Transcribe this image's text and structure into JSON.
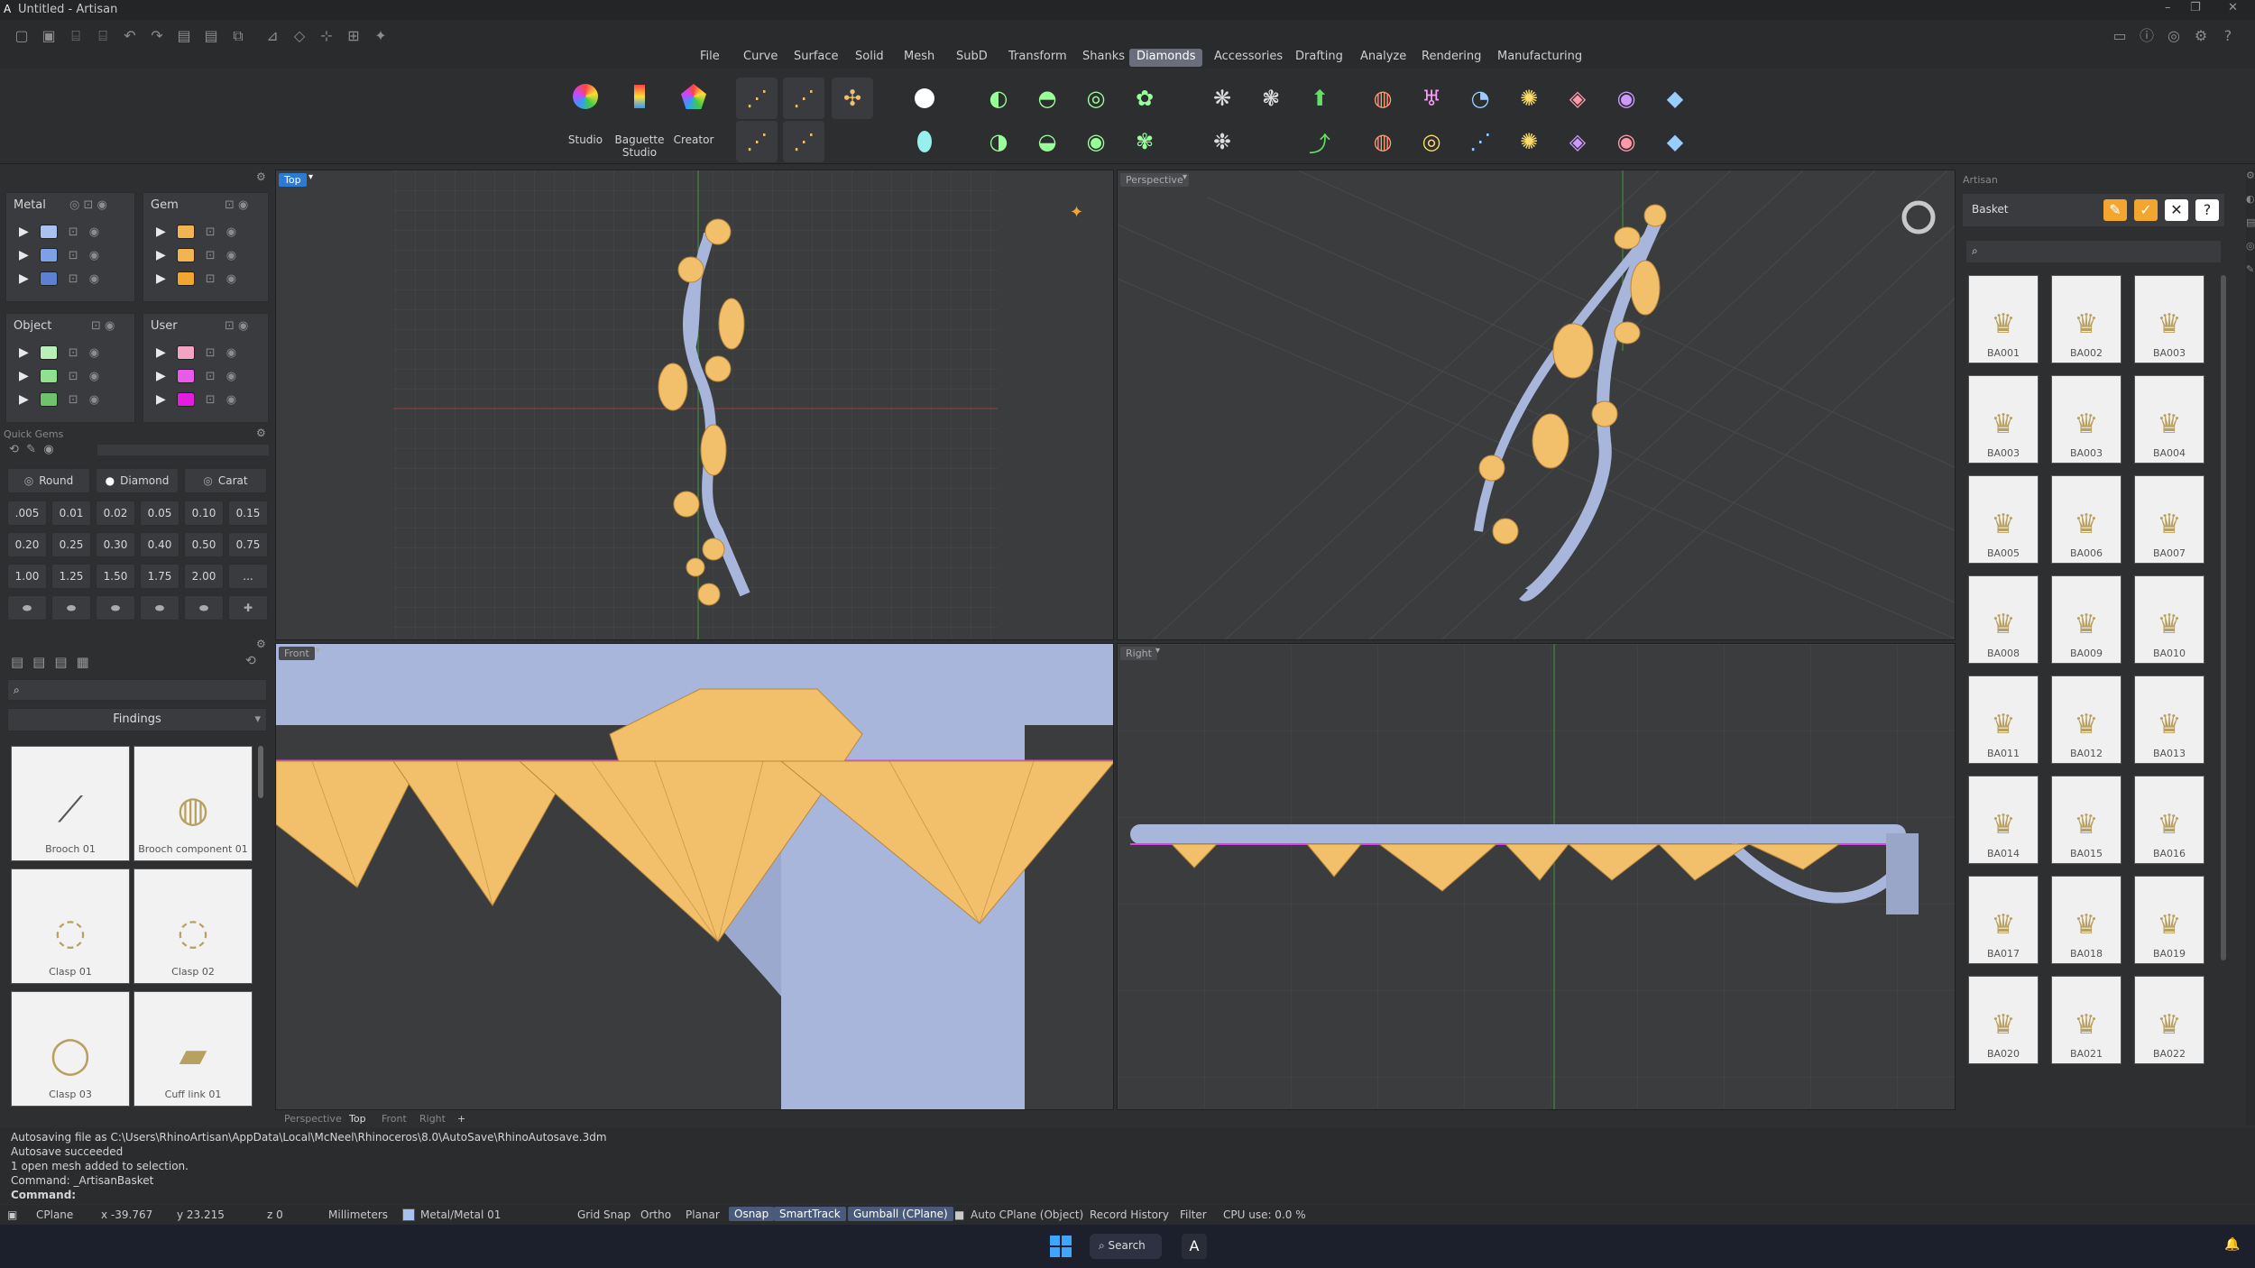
{
  "title_bar": {
    "title": "Untitled - Artisan"
  },
  "menu": {
    "tabs": [
      "File",
      "Curve",
      "Surface",
      "Solid",
      "Mesh",
      "SubD",
      "Transform",
      "Shanks",
      "Diamonds",
      "Accessories",
      "Drafting",
      "Analyze",
      "Rendering",
      "Manufacturing"
    ],
    "active": "Diamonds"
  },
  "ribbon": {
    "studio": "Studio",
    "baguette": "Baguette Studio",
    "creator": "Creator"
  },
  "layers": {
    "metal": {
      "title": "Metal",
      "colors": [
        "#a9c0f0",
        "#7ea0e6",
        "#5d80d0"
      ]
    },
    "gem": {
      "title": "Gem",
      "colors": [
        "#f2b451",
        "#f2b451",
        "#f2a630"
      ]
    },
    "object": {
      "title": "Object",
      "colors": [
        "#b8f0b8",
        "#8fe08f",
        "#6cc36c"
      ]
    },
    "user": {
      "title": "User",
      "colors": [
        "#f5a3c3",
        "#e95ae8",
        "#e21de0"
      ]
    }
  },
  "quick_gems": {
    "title": "Quick Gems",
    "buttons": [
      "Round",
      "Diamond",
      "Carat"
    ],
    "carats": [
      [
        ".005",
        "0.01",
        "0.02",
        "0.05",
        "0.10",
        "0.15"
      ],
      [
        "0.20",
        "0.25",
        "0.30",
        "0.40",
        "0.50",
        "0.75"
      ],
      [
        "1.00",
        "1.25",
        "1.50",
        "1.75",
        "2.00",
        "..."
      ]
    ]
  },
  "findings": {
    "dropdown": "Findings",
    "items": [
      {
        "name": "Brooch 01"
      },
      {
        "name": "Brooch component 01"
      },
      {
        "name": "Clasp 01"
      },
      {
        "name": "Clasp 02"
      },
      {
        "name": "Clasp 03"
      },
      {
        "name": "Cuff link 01"
      }
    ]
  },
  "viewports": {
    "top": "Top",
    "perspective": "Perspective",
    "front": "Front",
    "right": "Right"
  },
  "viewport_tabs": [
    "Perspective",
    "Top",
    "Front",
    "Right"
  ],
  "artisan_panel": {
    "title": "Artisan",
    "basket": "Basket",
    "items": [
      "BA001",
      "BA002",
      "BA003",
      "BA003",
      "BA003",
      "BA004",
      "BA005",
      "BA006",
      "BA007",
      "BA008",
      "BA009",
      "BA010",
      "BA011",
      "BA012",
      "BA013",
      "BA014",
      "BA015",
      "BA016",
      "BA017",
      "BA018",
      "BA019",
      "BA020",
      "BA021",
      "BA022"
    ]
  },
  "command": {
    "lines": [
      "Autosaving file as C:\\Users\\RhinoArtisan\\AppData\\Local\\McNeel\\Rhinoceros\\8.0\\AutoSave\\RhinoAutosave.3dm",
      "Autosave succeeded",
      "1 open mesh added to selection.",
      "Command: _ArtisanBasket"
    ],
    "prompt": "Command:"
  },
  "status": {
    "cplane": "CPlane",
    "x": "x -39.767",
    "y": "y 23.215",
    "z": "z 0",
    "units": "Millimeters",
    "layer": "Metal/Metal 01",
    "grid_snap": "Grid Snap",
    "ortho": "Ortho",
    "planar": "Planar",
    "osnap": "Osnap",
    "smarttrack": "SmartTrack",
    "gumball": "Gumball (CPlane)",
    "auto_cplane": "Auto CPlane (Object)",
    "record_history": "Record History",
    "filter": "Filter",
    "cpu": "CPU use: 0.0 %"
  },
  "taskbar": {
    "search": "Search"
  }
}
